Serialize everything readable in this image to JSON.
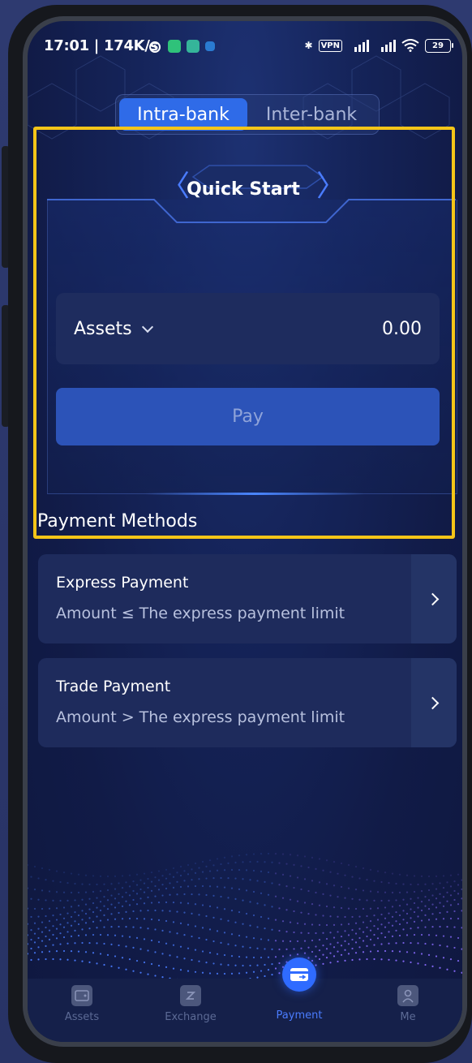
{
  "status_bar": {
    "time": "17:01 | 174K/s",
    "vpn": "VPN",
    "battery": "29"
  },
  "tabs": [
    {
      "label": "Intra-bank",
      "active": true
    },
    {
      "label": "Inter-bank",
      "active": false
    }
  ],
  "quick_start": {
    "title": "Quick Start",
    "prev_icon": "chevron-left-icon",
    "next_icon": "chevron-right-icon"
  },
  "assets_row": {
    "label": "Assets",
    "value": "0.00"
  },
  "pay_button": {
    "label": "Pay"
  },
  "payment_methods": {
    "title": "Payment Methods",
    "items": [
      {
        "name": "Express Payment",
        "desc": "Amount ≤ The express payment limit"
      },
      {
        "name": "Trade Payment",
        "desc": "Amount > The express payment limit"
      }
    ]
  },
  "bottom_nav": [
    {
      "label": "Assets",
      "icon": "wallet-icon",
      "active": false
    },
    {
      "label": "Exchange",
      "icon": "exchange-icon",
      "active": false
    },
    {
      "label": "Payment",
      "icon": "payment-icon",
      "active": true
    },
    {
      "label": "Me",
      "icon": "user-icon",
      "active": false
    }
  ],
  "colors": {
    "accent": "#2f6be8",
    "highlight": "#f5c518",
    "background": "#111b47"
  }
}
